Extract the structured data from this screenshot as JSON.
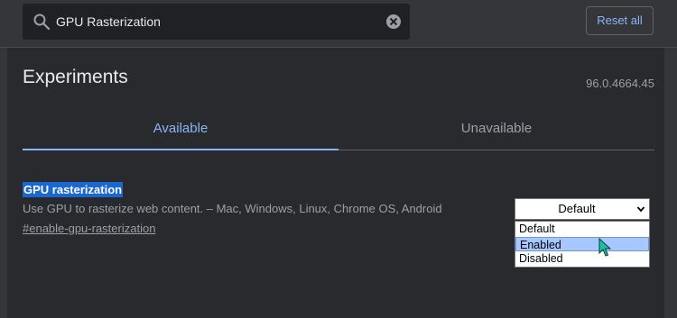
{
  "search": {
    "value": "GPU Rasterization",
    "icon": "search-icon",
    "clear_icon": "clear-icon"
  },
  "header": {
    "reset_label": "Reset all"
  },
  "page": {
    "title": "Experiments",
    "version": "96.0.4664.45"
  },
  "tabs": [
    {
      "label": "Available",
      "active": true
    },
    {
      "label": "Unavailable",
      "active": false
    }
  ],
  "experiment": {
    "name": "GPU rasterization",
    "description": "Use GPU to rasterize web content. – Mac, Windows, Linux, Chrome OS, Android",
    "link": "#enable-gpu-rasterization",
    "selected_value": "Default",
    "options": [
      "Default",
      "Enabled",
      "Disabled"
    ],
    "highlighted_option": "Enabled"
  },
  "colors": {
    "accent": "#8ab4f8",
    "background": "#292a2d",
    "header": "#35363a",
    "highlight": "#1a67d2"
  }
}
